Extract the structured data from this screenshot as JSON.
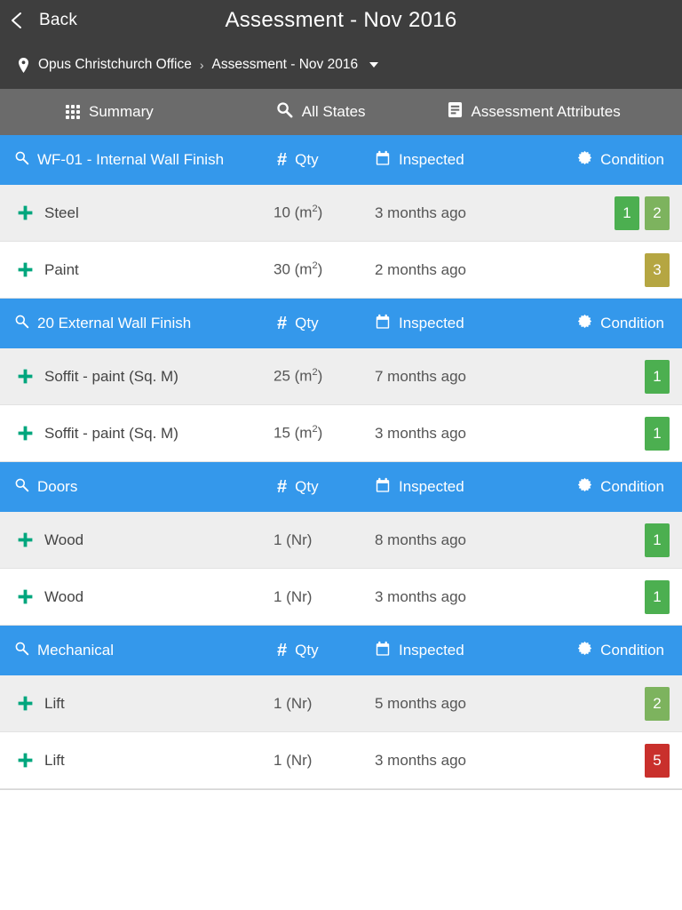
{
  "header": {
    "back_label": "Back",
    "back_icon": "chevron-left-icon",
    "title": "Assessment - Nov 2016",
    "breadcrumb": {
      "pin_icon": "map-pin-icon",
      "root": "Opus Christchurch Office",
      "separator": "›",
      "current": "Assessment - Nov 2016",
      "caret_icon": "caret-down-icon"
    }
  },
  "tabs": [
    {
      "label": "Summary",
      "icon": "grid-dots-icon",
      "active": false
    },
    {
      "label": "All States",
      "icon": "search-icon",
      "active": false
    },
    {
      "label": "Assessment Attributes",
      "icon": "list-document-icon",
      "active": false
    }
  ],
  "column_headers": {
    "title_icon": "search-icon",
    "qty_icon": "hash-icon",
    "qty": "Qty",
    "inspected_icon": "calendar-icon",
    "inspected": "Inspected",
    "condition_icon": "starburst-icon",
    "condition": "Condition"
  },
  "colors": {
    "header_bar": "#3e3e3e",
    "tab_bar": "#6b6b6b",
    "group_header_blue": "#3498eb",
    "row_alt": "#eeeeee",
    "plus_icon_teal": "#00a67d",
    "badge_1_green": "#4caf50",
    "badge_2_olive_green": "#7db35e",
    "badge_3_yellow": "#b5a642",
    "badge_5_red": "#c9302c"
  },
  "groups": [
    {
      "title": "WF-01 - Internal Wall Finish",
      "rows": [
        {
          "add_icon": "plus-icon",
          "name": "Steel",
          "qty_value": "10 (m",
          "qty_sup": "2",
          "qty_suffix": ")",
          "inspected": "3 months ago",
          "badges": [
            {
              "value": "1",
              "color": "#4caf50"
            },
            {
              "value": "2",
              "color": "#7db35e"
            }
          ]
        },
        {
          "add_icon": "plus-icon",
          "name": "Paint",
          "qty_value": "30 (m",
          "qty_sup": "2",
          "qty_suffix": ")",
          "inspected": "2 months ago",
          "badges": [
            {
              "value": "3",
              "color": "#b5a642"
            }
          ]
        }
      ]
    },
    {
      "title": "20 External Wall Finish",
      "rows": [
        {
          "add_icon": "plus-icon",
          "name": "Soffit - paint (Sq. M)",
          "qty_value": "25 (m",
          "qty_sup": "2",
          "qty_suffix": ")",
          "inspected": "7 months ago",
          "badges": [
            {
              "value": "1",
              "color": "#4caf50"
            }
          ]
        },
        {
          "add_icon": "plus-icon",
          "name": "Soffit - paint (Sq. M)",
          "qty_value": "15 (m",
          "qty_sup": "2",
          "qty_suffix": ")",
          "inspected": "3 months ago",
          "badges": [
            {
              "value": "1",
              "color": "#4caf50"
            }
          ]
        }
      ]
    },
    {
      "title": "Doors",
      "rows": [
        {
          "add_icon": "plus-icon",
          "name": "Wood",
          "qty_value": "1 (Nr)",
          "qty_sup": "",
          "qty_suffix": "",
          "inspected": "8 months ago",
          "badges": [
            {
              "value": "1",
              "color": "#4caf50"
            }
          ]
        },
        {
          "add_icon": "plus-icon",
          "name": "Wood",
          "qty_value": "1 (Nr)",
          "qty_sup": "",
          "qty_suffix": "",
          "inspected": "3 months ago",
          "badges": [
            {
              "value": "1",
              "color": "#4caf50"
            }
          ]
        }
      ]
    },
    {
      "title": "Mechanical",
      "rows": [
        {
          "add_icon": "plus-icon",
          "name": "Lift",
          "qty_value": "1 (Nr)",
          "qty_sup": "",
          "qty_suffix": "",
          "inspected": "5 months ago",
          "badges": [
            {
              "value": "2",
              "color": "#7db35e"
            }
          ]
        },
        {
          "add_icon": "plus-icon",
          "name": "Lift",
          "qty_value": "1 (Nr)",
          "qty_sup": "",
          "qty_suffix": "",
          "inspected": "3 months ago",
          "badges": [
            {
              "value": "5",
              "color": "#c9302c"
            }
          ]
        }
      ]
    }
  ]
}
